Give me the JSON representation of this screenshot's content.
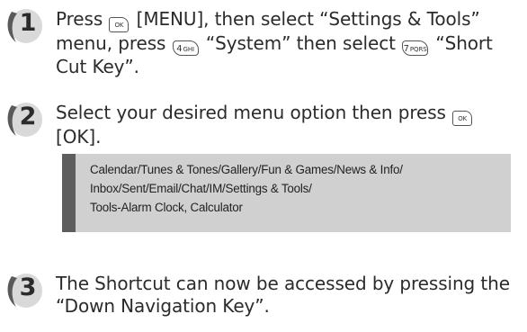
{
  "steps": [
    {
      "number": "1",
      "segments": [
        {
          "type": "text",
          "text": "Press "
        },
        {
          "type": "key",
          "kind": "ok",
          "label": "OK"
        },
        {
          "type": "text",
          "text": " [MENU], then select “Settings & Tools” menu, press "
        },
        {
          "type": "key",
          "kind": "num",
          "digit": "4",
          "letters": "GHI"
        },
        {
          "type": "text",
          "text": " “System” then select "
        },
        {
          "type": "key",
          "kind": "num",
          "digit": "7",
          "letters": "PQRS"
        },
        {
          "type": "text",
          "text": " “Short Cut Key”."
        }
      ]
    },
    {
      "number": "2",
      "segments": [
        {
          "type": "text",
          "text": "Select your desired menu option then press "
        },
        {
          "type": "key",
          "kind": "ok",
          "label": "OK"
        },
        {
          "type": "text",
          "text": " [OK]."
        }
      ]
    },
    {
      "number": "3",
      "segments": [
        {
          "type": "text",
          "text": "The Shortcut can now be accessed by pressing the “Down Navigation Key”."
        }
      ]
    }
  ],
  "note": {
    "lines": [
      "Calendar/Tunes & Tones/Gallery/Fun & Games/News & Info/",
      "Inbox/Sent/Email/Chat/IM/Settings & Tools/",
      "Tools-Alarm Clock, Calculator"
    ]
  },
  "colors": {
    "badge_dark": "#5a5a5a",
    "badge_light": "#d9d9d9",
    "note_bg": "#d0d0d0",
    "note_bar": "#5d5d5d"
  }
}
